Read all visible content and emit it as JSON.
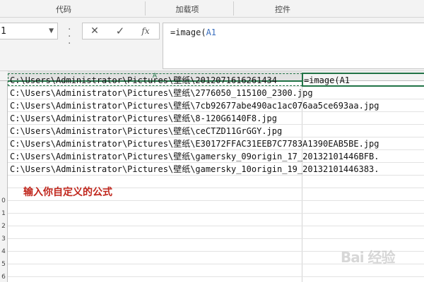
{
  "ribbon": {
    "groups": [
      "代码",
      "加载项",
      "控件"
    ]
  },
  "formula_bar": {
    "name_box": "1",
    "cancel_icon": "✕",
    "enter_icon": "✓",
    "fx_label": "fx",
    "formula_prefix": "=image(",
    "formula_ref": "A1"
  },
  "grid": {
    "column_headers": [
      "A"
    ],
    "row_numbers": [
      "0",
      "1",
      "2",
      "3",
      "4",
      "5",
      "6"
    ],
    "cells": [
      "C:\\Users\\Administrator\\Pictures\\壁纸\\2012071616261434",
      "C:\\Users\\Administrator\\Pictures\\壁纸\\2776050_115100_2300.jpg",
      "C:\\Users\\Administrator\\Pictures\\壁纸\\7cb92677abe490ac1ac076aa5ce693aa.jpg",
      "C:\\Users\\Administrator\\Pictures\\壁纸\\8-120G6140F8.jpg",
      "C:\\Users\\Administrator\\Pictures\\壁纸\\ceCTZD11GrGGY.jpg",
      "C:\\Users\\Administrator\\Pictures\\壁纸\\E30172FFAC31EEB7C7783A1390EAB5BE.jpg",
      "C:\\Users\\Administrator\\Pictures\\壁纸\\gamersky_09origin_17_20132101446BFB.",
      "C:\\Users\\Administrator\\Pictures\\壁纸\\gamersky_10origin_19_20132101446383."
    ],
    "edit_cell": {
      "prefix": "=image(",
      "ref": "A1"
    }
  },
  "annotation": "输入你自定义的公式",
  "watermark": "Bai 经验",
  "colors": {
    "accent_green": "#217346",
    "annotation_red": "#c0261c",
    "ref_blue": "#3a6fbf"
  }
}
